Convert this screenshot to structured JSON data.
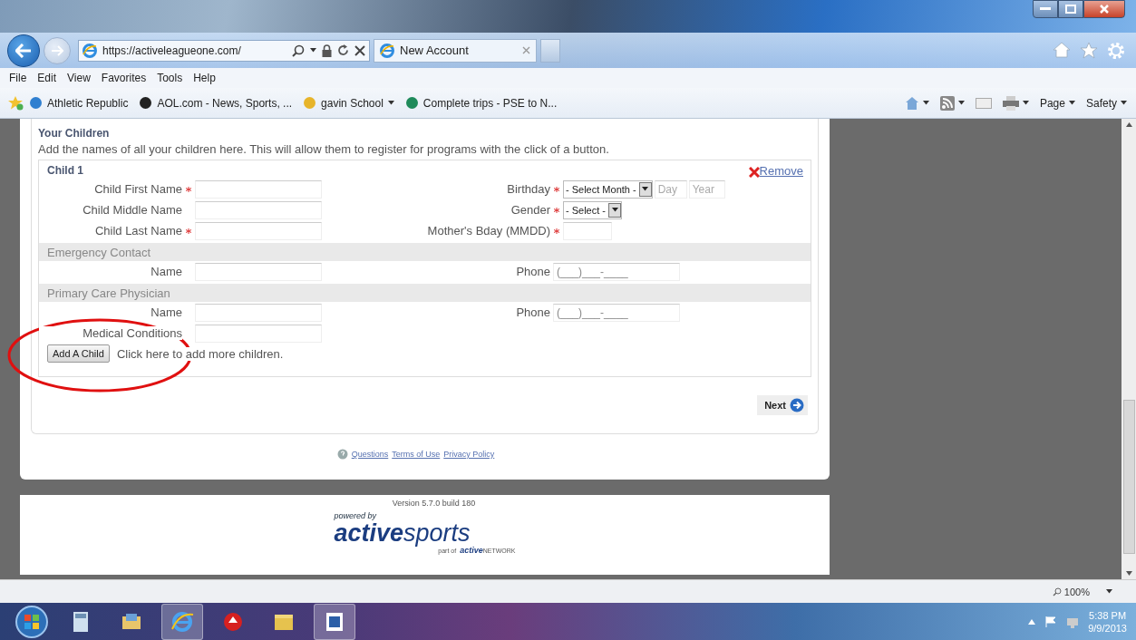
{
  "browser": {
    "address": "https://activeleagueone.com/",
    "tab": {
      "label": "New Account"
    },
    "menu": [
      "File",
      "Edit",
      "View",
      "Favorites",
      "Tools",
      "Help"
    ],
    "favorites": [
      {
        "label": "Athletic Republic",
        "dropdown": false
      },
      {
        "label": "AOL.com - News, Sports, ...",
        "dropdown": false
      },
      {
        "label": "gavin School",
        "dropdown": true
      },
      {
        "label": "Complete trips - PSE to N...",
        "dropdown": false
      }
    ],
    "commands": [
      "Page",
      "Safety"
    ]
  },
  "form": {
    "title": "Your Children",
    "intro": "Add the names of all your children here. This will allow them to register for programs with the click of a button.",
    "child": {
      "title": "Child 1",
      "remove": "Remove",
      "rows": [
        {
          "left": {
            "label": "Child First Name",
            "required": true
          },
          "right": {
            "kind": "date",
            "label": "Birthday",
            "required": true,
            "select": "- Select Month -",
            "day_placeholder": "Day",
            "year_placeholder": "Year"
          }
        },
        {
          "left": {
            "label": "Child Middle Name",
            "required": false
          },
          "right": {
            "kind": "select",
            "label": "Gender",
            "required": true,
            "select": "- Select -"
          }
        },
        {
          "left": {
            "label": "Child Last Name",
            "required": true
          },
          "right": {
            "kind": "text",
            "label": "Mother's Bday (MMDD)",
            "required": true
          }
        }
      ],
      "sections": [
        {
          "title": "Emergency Contact",
          "name_label": "Name",
          "phone_label": "Phone",
          "phone_value": "(___)___-____"
        },
        {
          "title": "Primary Care Physician",
          "name_label": "Name",
          "phone_label": "Phone",
          "phone_value": "(___)___-____"
        }
      ],
      "medical_label": "Medical Conditions"
    },
    "add_button": "Add A Child",
    "add_hint": "Click here to add more children.",
    "next": "Next"
  },
  "footer_links": [
    "Questions",
    "Terms of Use",
    "Privacy Policy"
  ],
  "footer": {
    "version": "Version 5.7.0 build 180",
    "powered_by": "powered by",
    "logo_bold": "active",
    "logo_light": "sports",
    "part_of": "part of",
    "network_bold": "active",
    "network_light": "NETWORK"
  },
  "status_bar": {
    "zoom": "100%"
  },
  "taskbar": {
    "time": "5:38 PM",
    "date": "9/9/2013"
  }
}
